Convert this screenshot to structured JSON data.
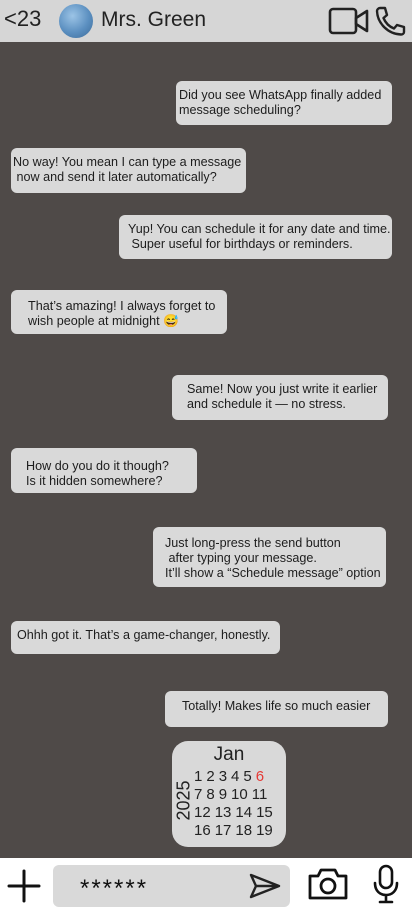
{
  "header": {
    "back_label": "<23",
    "contact_name": "Mrs. Green",
    "icons": [
      "video-call-icon",
      "phone-call-icon"
    ],
    "background": "#d6d6d6"
  },
  "messages": [
    {
      "direction": "outgoing",
      "text": "Did you see WhatsApp finally added\nmessage scheduling?"
    },
    {
      "direction": "incoming",
      "text": "No way! You mean I can type a message\n now and send it later automatically?"
    },
    {
      "direction": "outgoing",
      "text": "Yup! You can schedule it for any date and time.\n Super useful for birthdays or reminders."
    },
    {
      "direction": "incoming",
      "text": "That’s amazing! I always forget to\nwish people at midnight 😅"
    },
    {
      "direction": "outgoing",
      "text": "Same! Now you just write it earlier\nand schedule it — no stress."
    },
    {
      "direction": "incoming",
      "text": "How do you do it though?\nIs it hidden somewhere?"
    },
    {
      "direction": "outgoing",
      "text": "Just long-press the send button\n after typing your message.\nIt’ll show a “Schedule message” option"
    },
    {
      "direction": "incoming",
      "text": "Ohhh got it. That’s a game-changer, honestly."
    },
    {
      "direction": "outgoing",
      "text": "Totally! Makes life so much easier"
    }
  ],
  "calendar": {
    "month": "Jan",
    "year": "2025",
    "rows": [
      [
        "1",
        "2",
        "3",
        "4",
        "5",
        "6"
      ],
      [
        "7",
        "8",
        "9",
        "10",
        "11"
      ],
      [
        "12",
        "13",
        "14",
        "15"
      ],
      [
        "16",
        "17",
        "18",
        "19"
      ]
    ],
    "highlighted_day": "6",
    "highlight_color": "#e53935"
  },
  "composer": {
    "input_value": "******",
    "icons": [
      "plus-icon",
      "send-icon",
      "camera-icon",
      "microphone-icon"
    ]
  },
  "colors": {
    "chat_background": "#4f4a48",
    "bubble": "#d9d9d9"
  }
}
